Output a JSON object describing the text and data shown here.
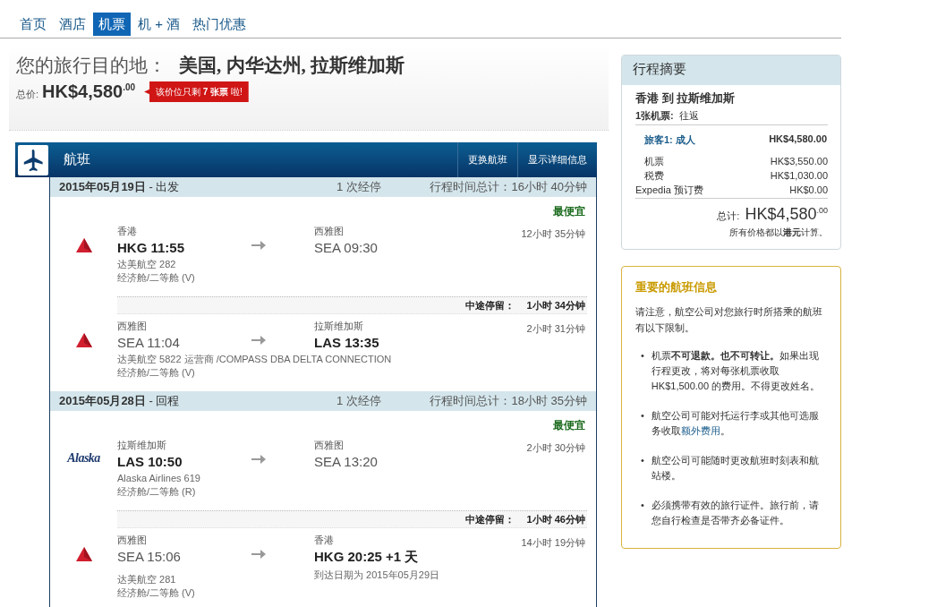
{
  "nav": [
    {
      "label": "首页",
      "selected": false
    },
    {
      "label": "酒店",
      "selected": false
    },
    {
      "label": "机票",
      "selected": true
    },
    {
      "label": "机 + 酒",
      "selected": false
    },
    {
      "label": "热门优惠",
      "selected": false
    }
  ],
  "destination": {
    "label": "您的旅行目的地：",
    "value": "美国, 内华达州, 拉斯维加斯"
  },
  "total": {
    "label": "总价:",
    "price": "HK$4,580$^{.00}$",
    "badge": "该价位只剩 **7 张票** 啦!"
  },
  "flights": {
    "title": "航班",
    "actions": [
      "更换航班",
      "显示详细信息"
    ],
    "legs": [
      {
        "date": "**2015年05月19日** - 出发",
        "stops": "1 次经停",
        "total": "行程时间总计：16小时 40分钟",
        "tag": "最便宜",
        "segments": [
          {
            "logo": {
              "kind": "delta"
            },
            "from_city": "香港",
            "from": "HKG 11:55",
            "from_bold": true,
            "to_city": "西雅图",
            "to": "SEA 09:30",
            "to_bold": false,
            "duration": "12小时 35分钟",
            "info": [
              "达美航空 282",
              "经济舱/二等舱 (V)"
            ]
          },
          {
            "layover_label": "中途停留：",
            "layover": "1小时 34分钟",
            "logo": {
              "kind": "delta"
            },
            "from_city": "西雅图",
            "from": "SEA 11:04",
            "from_bold": false,
            "to_city": "拉斯维加斯",
            "to": "LAS 13:35",
            "to_bold": true,
            "duration": "2小时 31分钟",
            "info": [
              "达美航空 5822 运营商 /COMPASS DBA DELTA CONNECTION",
              "经济舱/二等舱 (V)"
            ]
          }
        ]
      },
      {
        "date": "**2015年05月28日** - 回程",
        "stops": "1 次经停",
        "total": "行程时间总计：18小时 35分钟",
        "tag": "最便宜",
        "segments": [
          {
            "logo": {
              "kind": "alaska",
              "text": "Alaska"
            },
            "from_city": "拉斯维加斯",
            "from": "LAS 10:50",
            "from_bold": true,
            "to_city": "西雅图",
            "to": "SEA 13:20",
            "to_bold": false,
            "duration": "2小时 30分钟",
            "info": [
              "Alaska Airlines 619",
              "经济舱/二等舱 (R)"
            ]
          },
          {
            "layover_label": "中途停留：",
            "layover": "1小时 46分钟",
            "logo": {
              "kind": "delta"
            },
            "from_city": "西雅图",
            "from": "SEA 15:06",
            "from_bold": false,
            "to_city": "香港",
            "to": "HKG 20:25 +1 天",
            "to_bold": true,
            "arrival_note": "到达日期为 2015年05月29日",
            "duration": "14小时 19分钟",
            "info": [
              "达美航空 281",
              "经济舱/二等舱 (V)"
            ]
          }
        ]
      }
    ]
  },
  "summary": {
    "title": "行程摘要",
    "route": "香港 到 拉斯维加斯",
    "tickets_label": "1张机票:",
    "tickets": "往返",
    "traveler": "旅客1: 成人",
    "traveler_price": "HK$4,580.00",
    "lines": [
      {
        "label": "机票",
        "value": "HK$3,550.00"
      },
      {
        "label": "税费",
        "value": "HK$1,030.00"
      },
      {
        "label": "Expedia 预订费",
        "value": "HK$0.00"
      }
    ],
    "total_label": "总计:",
    "total": "HK$4,580$^{.00}$",
    "note": "所有价格都以**港元**计算。"
  },
  "info": {
    "title": "重要的航班信息",
    "intro": "请注意，航空公司对您旅行时所搭乘的航班有以下限制。",
    "bullets": [
      {
        "marker": "•",
        "text": "机票**不可退款。也不可转让。**如果出现行程更改，将对每张机票收取 HK$1,500.00 的费用。不得更改姓名。"
      },
      {
        "marker": "•",
        "text": "航空公司可能对托运行李或其他可选服务收取",
        "link": "额外费用",
        "after": "。"
      },
      {
        "marker": "•",
        "text": "航空公司可能随时更改航班时刻表和航站楼。"
      },
      {
        "marker": "•",
        "text": "必须携带有效的旅行证件。旅行前，请您自行检查是否带齐必备证件。"
      }
    ]
  }
}
